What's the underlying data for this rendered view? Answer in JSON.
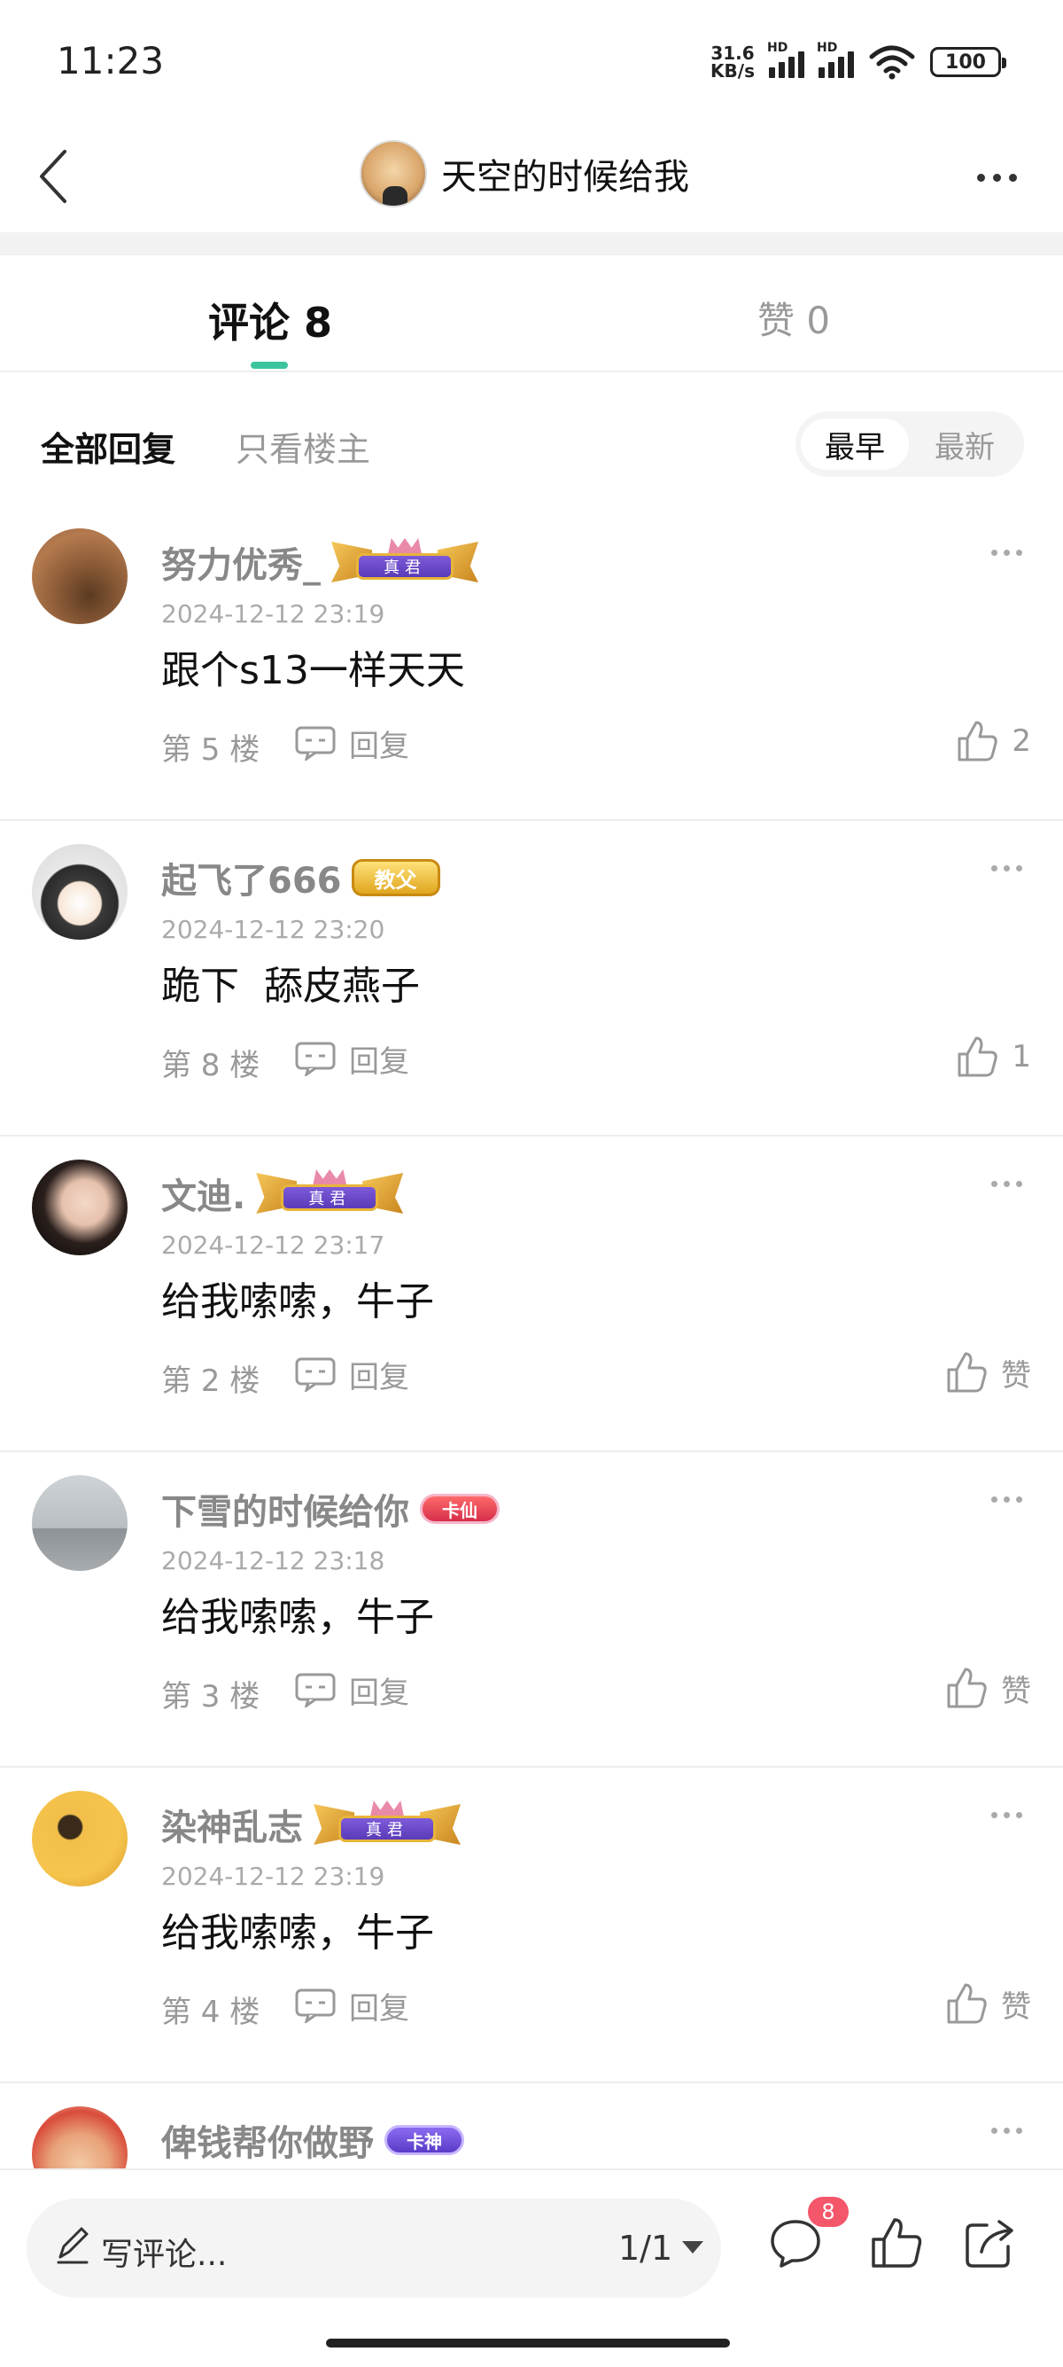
{
  "status_bar": {
    "time": "11:23",
    "net_speed_value": "31.6",
    "net_speed_unit": "KB/s",
    "signal_label": "HD",
    "battery": "100"
  },
  "header": {
    "title": "天空的时候给我"
  },
  "tabs": [
    {
      "label": "评论 8",
      "active": true
    },
    {
      "label": "赞 0",
      "active": false
    }
  ],
  "filters": {
    "all_replies": "全部回复",
    "op_only": "只看楼主",
    "sort_earliest": "最早",
    "sort_latest": "最新"
  },
  "reply_label": "回复",
  "comments": [
    {
      "name": "努力优秀_",
      "badge": "真君",
      "time": "2024-12-12 23:19",
      "text": "跟个s13一样天天",
      "floor": "第 5 楼",
      "likes": "2"
    },
    {
      "name": "起飞了666",
      "badge": "教父",
      "time": "2024-12-12 23:20",
      "text": "跪下  舔皮燕子",
      "floor": "第 8 楼",
      "likes": "1"
    },
    {
      "name": "文迪.",
      "badge": "真君",
      "time": "2024-12-12 23:17",
      "text": "给我嗦嗦，牛子",
      "floor": "第 2 楼",
      "likes": "赞"
    },
    {
      "name": "下雪的时候给你",
      "badge": "卡仙",
      "time": "2024-12-12 23:18",
      "text": "给我嗦嗦，牛子",
      "floor": "第 3 楼",
      "likes": "赞"
    },
    {
      "name": "染神乱志",
      "badge": "真君",
      "time": "2024-12-12 23:19",
      "text": "给我嗦嗦，牛子",
      "floor": "第 4 楼",
      "likes": "赞"
    },
    {
      "name": "俾钱帮你做野",
      "badge": "卡神"
    }
  ],
  "bottom_bar": {
    "write_placeholder": "写评论...",
    "page_indicator": "1/1",
    "comment_count_badge": "8"
  },
  "colors": {
    "accent": "#3cc59c",
    "badge_red": "#f4566a"
  }
}
